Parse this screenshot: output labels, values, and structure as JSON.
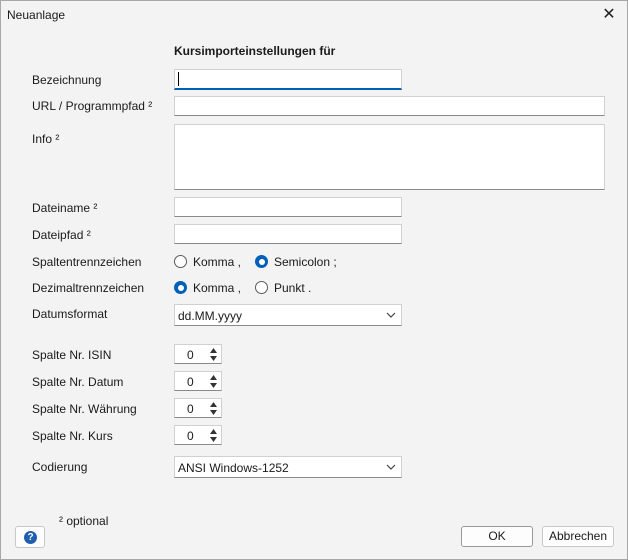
{
  "window": {
    "title": "Neuanlage",
    "close_glyph": "✕"
  },
  "form": {
    "heading": "Kursimporteinstellungen für",
    "fields": {
      "bezeichnung_label": "Bezeichnung",
      "bezeichnung_value": "",
      "url_label": "URL / Programmpfad ²",
      "url_value": "",
      "info_label": "Info ²",
      "info_value": "",
      "dateiname_label": "Dateiname ²",
      "dateiname_value": "",
      "dateipfad_label": "Dateipfad ²",
      "dateipfad_value": ""
    },
    "spaltentrenn": {
      "label": "Spaltentrennzeichen",
      "options": [
        {
          "label": "Komma ,",
          "checked": false
        },
        {
          "label": "Semicolon ;",
          "checked": true
        }
      ]
    },
    "dezimaltrenn": {
      "label": "Dezimaltrennzeichen",
      "options": [
        {
          "label": "Komma ,",
          "checked": true
        },
        {
          "label": "Punkt .",
          "checked": false
        }
      ]
    },
    "datumsformat": {
      "label": "Datumsformat",
      "value": "dd.MM.yyyy"
    },
    "spalten": [
      {
        "label": "Spalte Nr.  ISIN",
        "value": "0"
      },
      {
        "label": "Spalte Nr.  Datum",
        "value": "0"
      },
      {
        "label": "Spalte Nr.  Währung",
        "value": "0"
      },
      {
        "label": "Spalte Nr.  Kurs",
        "value": "0"
      }
    ],
    "codierung": {
      "label": "Codierung",
      "value": "ANSI Windows-1252"
    },
    "optional_note": "² optional"
  },
  "footer": {
    "help_glyph": "?",
    "ok_label": "OK",
    "cancel_label": "Abbrechen"
  },
  "icons": {
    "close": "close-icon",
    "dropdown": "chevron-down-icon",
    "spin_up": "spin-up-icon",
    "spin_down": "spin-down-icon",
    "help": "help-icon"
  },
  "colors": {
    "accent": "#005fb8",
    "help": "#1f5fb0",
    "window_bg": "#f3f3f3"
  }
}
